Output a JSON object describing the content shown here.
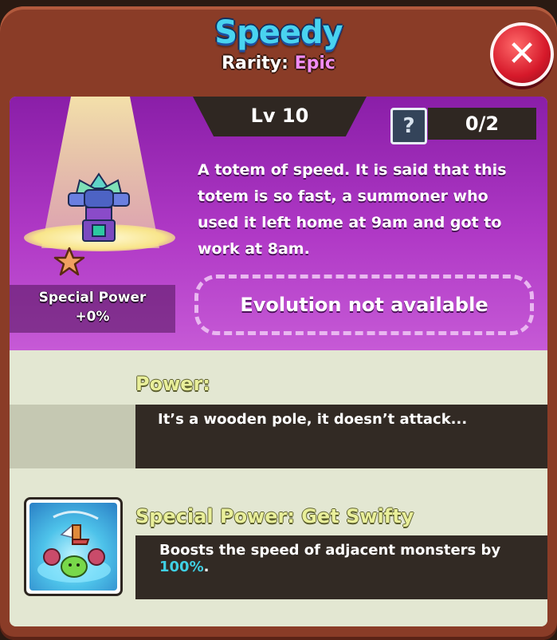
{
  "header": {
    "title": "Speedy",
    "rarity_label": "Rarity:",
    "rarity_value": "Epic",
    "close_symbol": "✕"
  },
  "monster": {
    "level": "Lv 10",
    "help_symbol": "?",
    "count": "0/2",
    "description": "A totem of speed. It is said that this totem is so fast, a summoner who used it left home at 9am and got to work at 8am.",
    "special_power_label": "Special Power",
    "special_power_value": "+0%",
    "evolution_status": "Evolution not available"
  },
  "power": {
    "label": "Power:",
    "description": "It’s a wooden pole, it doesn’t attack..."
  },
  "special_power": {
    "label": "Special Power: Get Swifty",
    "description_prefix": "Boosts the speed of adjacent monsters by ",
    "description_value": "100%",
    "description_suffix": "."
  },
  "colors": {
    "title": "#49d3f0",
    "rarity_epic": "#f08cf5",
    "accent_percent": "#3fd0e4",
    "panel": "#8a3c27"
  }
}
